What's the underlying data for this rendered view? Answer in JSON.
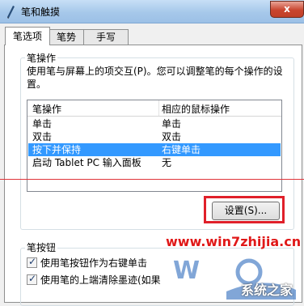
{
  "window": {
    "title": "笔和触摸",
    "close_glyph": "x"
  },
  "tabs": [
    {
      "label": "笔选项",
      "active": true
    },
    {
      "label": "笔势",
      "active": false
    },
    {
      "label": "手写",
      "active": false
    }
  ],
  "pen_actions": {
    "group_label": "笔操作",
    "description": "使用笔与屏幕上的项交互(P)。您可以调整笔的每个操作的设置。",
    "columns": [
      "笔操作",
      "相应的鼠标操作"
    ],
    "rows": [
      {
        "action": "单击",
        "mouse": "单击",
        "selected": false
      },
      {
        "action": "双击",
        "mouse": "双击",
        "selected": false
      },
      {
        "action": "按下并保持",
        "mouse": "右键单击",
        "selected": true
      },
      {
        "action": "启动 Tablet PC 输入面板",
        "mouse": "无",
        "selected": false
      }
    ],
    "settings_button": "设置(S)..."
  },
  "pen_buttons": {
    "group_label": "笔按钮",
    "options": [
      {
        "label": "使用笔按钮作为右键单击",
        "checked": true
      },
      {
        "label": "使用笔的上端清除墨迹(如果",
        "checked": true
      }
    ]
  },
  "watermark": {
    "url": "www.win7zhijia.cn",
    "logo": "系统之家"
  },
  "colors": {
    "accent_red": "#e0202a",
    "selection": "#3399ff"
  }
}
